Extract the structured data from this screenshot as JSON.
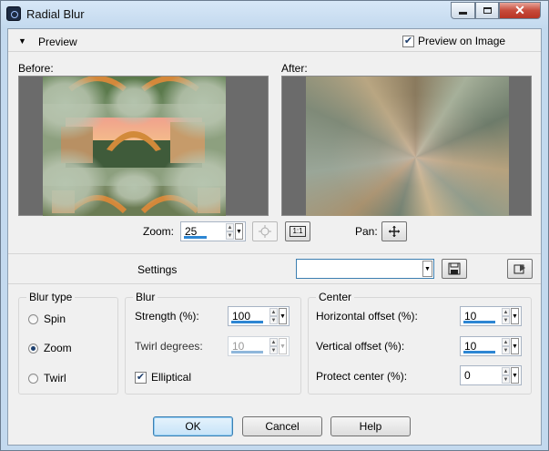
{
  "window": {
    "title": "Radial Blur",
    "icon": "paintshop-app-icon",
    "controls": {
      "minimize": "minimize-icon",
      "maximize": "maximize-icon",
      "close": "✕"
    }
  },
  "preview": {
    "header_label": "Preview",
    "preview_on_image_label": "Preview on Image",
    "preview_on_image_checked": true,
    "before_label": "Before:",
    "after_label": "After:",
    "zoom_label": "Zoom:",
    "zoom_value": "25",
    "zoom_fit_icon": "zoom-fit-icon",
    "zoom_one_to_one_label": "1:1",
    "pan_label": "Pan:",
    "pan_icon": "move-cross-icon"
  },
  "settings": {
    "label": "Settings",
    "preset_value": "",
    "save_icon": "save-disk-icon",
    "reset_icon": "preset-reset-icon"
  },
  "blur_type": {
    "title": "Blur type",
    "options": [
      {
        "label": "Spin",
        "selected": false
      },
      {
        "label": "Zoom",
        "selected": true
      },
      {
        "label": "Twirl",
        "selected": false
      }
    ]
  },
  "blur": {
    "title": "Blur",
    "strength_label": "Strength (%):",
    "strength_value": "100",
    "twirl_label": "Twirl degrees:",
    "twirl_value": "10",
    "elliptical_label": "Elliptical",
    "elliptical_checked": true
  },
  "center": {
    "title": "Center",
    "h_offset_label": "Horizontal offset (%):",
    "h_offset_value": "10",
    "v_offset_label": "Vertical offset (%):",
    "v_offset_value": "10",
    "protect_label": "Protect center (%):",
    "protect_value": "0"
  },
  "buttons": {
    "ok": "OK",
    "cancel": "Cancel",
    "help": "Help"
  },
  "colors": {
    "accent": "#2d86d3",
    "default_button": "#c6e3f8"
  }
}
